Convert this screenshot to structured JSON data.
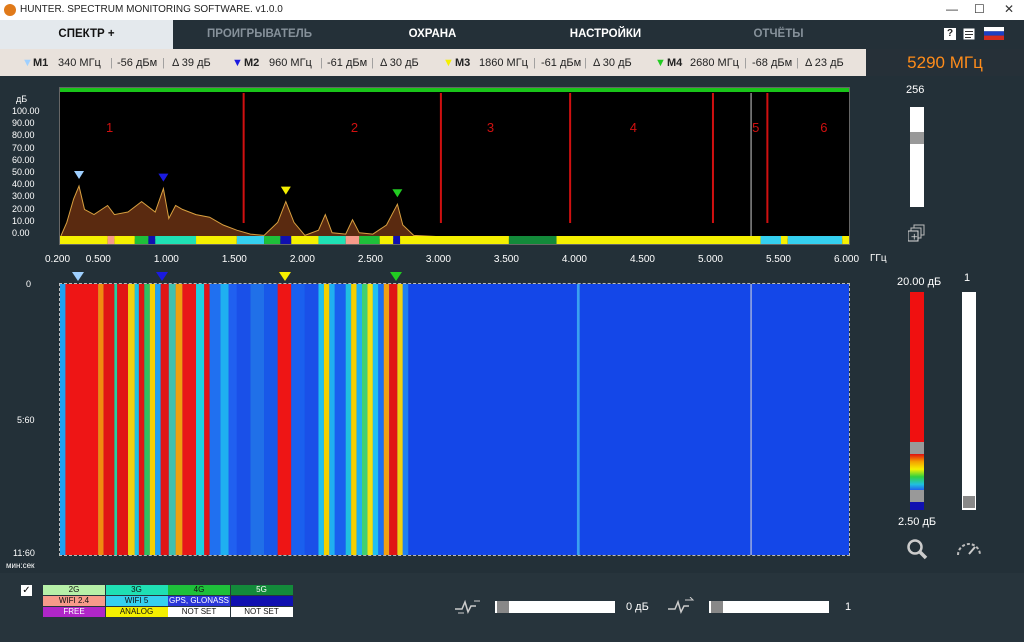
{
  "window": {
    "title": "HUNTER. SPECTRUM MONITORING SOFTWARE. v1.0.0",
    "minimize": "—",
    "maximize": "☐",
    "close": "✕"
  },
  "tabs": [
    {
      "label": "СПЕКТР +",
      "state": "active"
    },
    {
      "label": "ПРОИГРЫВАТЕЛЬ",
      "state": "dim"
    },
    {
      "label": "ОХРАНА",
      "state": "normal"
    },
    {
      "label": "НАСТРОЙКИ",
      "state": "normal"
    },
    {
      "label": "ОТЧЁТЫ",
      "state": "dim"
    }
  ],
  "top_icons": {
    "help": "?",
    "doc": "doc-icon",
    "lang": "ru-flag-icon"
  },
  "markers": [
    {
      "name": "M1",
      "freq": "340 МГц",
      "level": "-56 дБм",
      "delta": "Δ 39 дБ",
      "color": "#9fd0ff"
    },
    {
      "name": "M2",
      "freq": "960 МГц",
      "level": "-61 дБм",
      "delta": "Δ 30 дБ",
      "color": "#1a1ae0"
    },
    {
      "name": "M3",
      "freq": "1860 МГц",
      "level": "-61 дБм",
      "delta": "Δ 30 дБ",
      "color": "#f5f000"
    },
    {
      "name": "M4",
      "freq": "2680 МГц",
      "level": "-68 дБм",
      "delta": "Δ 23 дБ",
      "color": "#22cc22"
    }
  ],
  "center_freq": "5290 МГц",
  "spectrum": {
    "y_unit": "дБ",
    "y_ticks": [
      "100.00",
      "90.00",
      "80.00",
      "70.00",
      "60.00",
      "50.00",
      "40.00",
      "30.00",
      "20.00",
      "10.00",
      "0.00"
    ],
    "x_unit": "ГГц",
    "x_ticks": [
      "0.200",
      "0.500",
      "1.000",
      "1.500",
      "2.000",
      "2.500",
      "3.000",
      "3.500",
      "4.000",
      "4.500",
      "5.000",
      "5.500",
      "6.000"
    ],
    "zones": [
      "1",
      "2",
      "3",
      "4",
      "5",
      "6"
    ]
  },
  "right_panel": {
    "top_value": "256",
    "db_max": "20.00 дБ",
    "db_min": "2.50 дБ",
    "speed_value": "1"
  },
  "waterfall": {
    "y_ticks": [
      "0",
      "5:60",
      "11:60"
    ],
    "y_unit": "мин:сек"
  },
  "legend": {
    "rows": [
      [
        {
          "label": "2G",
          "color": "#b7f0a8"
        },
        {
          "label": "3G",
          "color": "#1fe0b4"
        },
        {
          "label": "4G",
          "color": "#1ebf3a"
        },
        {
          "label": "5G",
          "color": "#138a3a"
        }
      ],
      [
        {
          "label": "WIFI 2.4",
          "color": "#f79a8a"
        },
        {
          "label": "WIFI 5",
          "color": "#35d0f0"
        },
        {
          "label": "GPS, GLONASS",
          "color": "#2a36d8"
        },
        {
          "label": "",
          "color": "#1010b0"
        }
      ],
      [
        {
          "label": "FREE",
          "color": "#b026c8"
        },
        {
          "label": "ANALOG",
          "color": "#f5f000"
        },
        {
          "label": "NOT SET",
          "color": "#ffffff"
        },
        {
          "label": "NOT SET",
          "color": "#ffffff"
        }
      ]
    ]
  },
  "controls": {
    "gain_value": "0 дБ",
    "speed_value": "1"
  }
}
